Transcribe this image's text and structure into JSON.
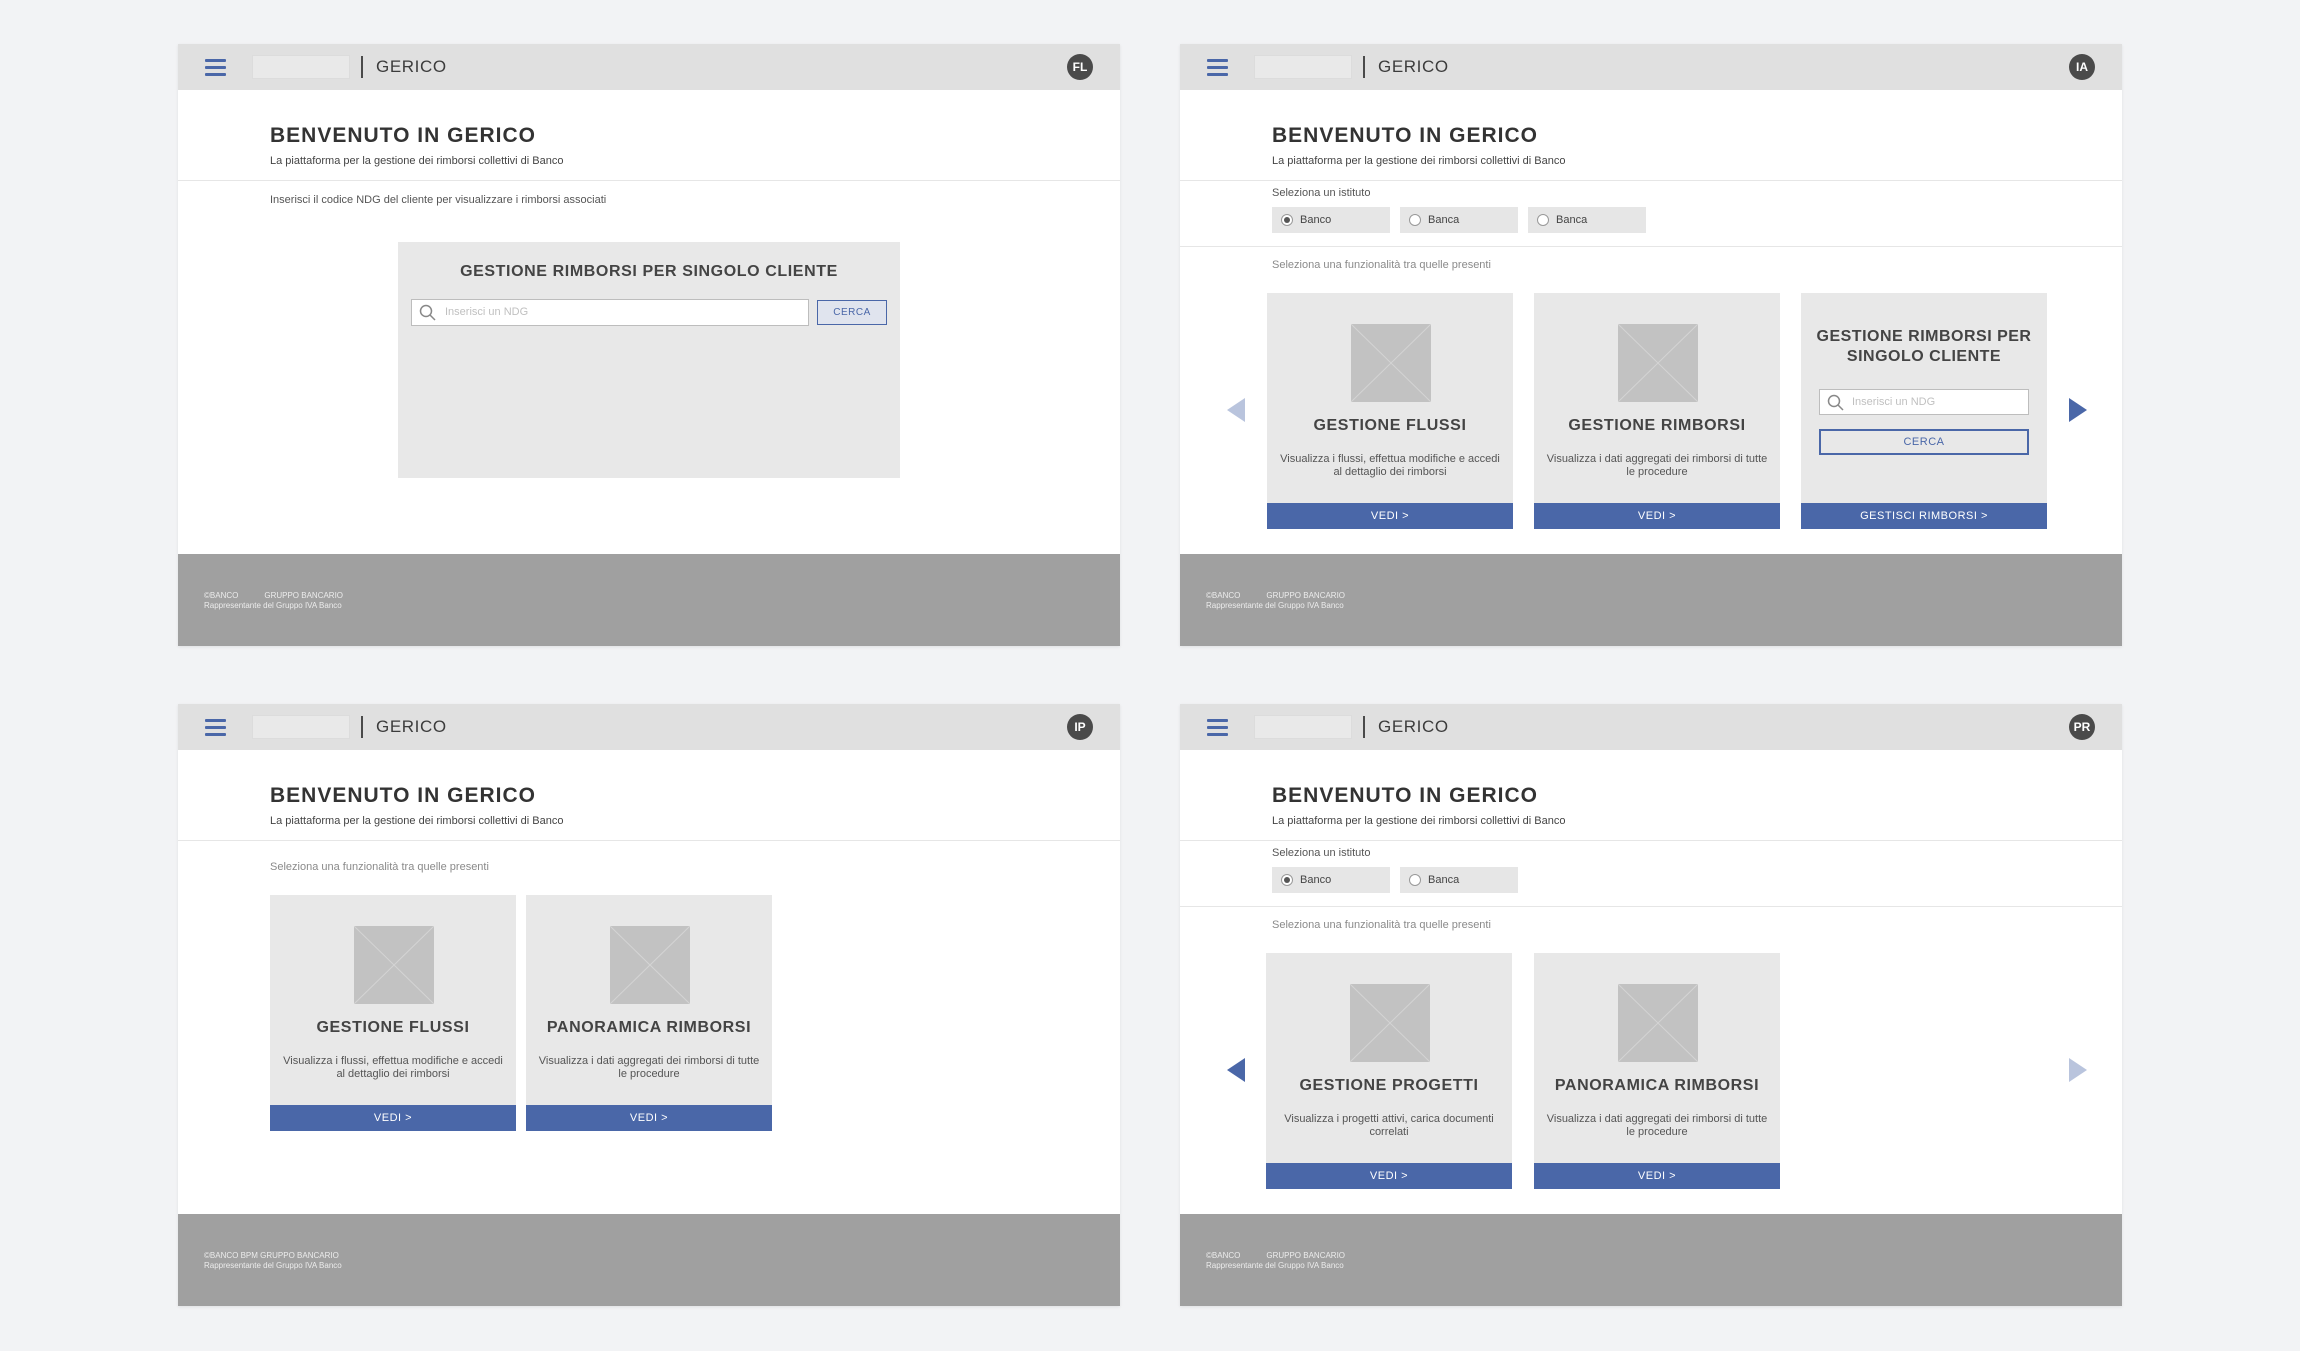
{
  "shared": {
    "app_name": "GERICO",
    "welcome_title": "BENVENUTO IN GERICO",
    "welcome_subtitle": "La piattaforma per la gestione dei rimborsi collettivi di Banco",
    "select_institute_label": "Seleziona un istituto",
    "select_function_hint": "Seleziona una funzionalità tra quelle presenti",
    "search_placeholder": "Inserisci un NDG",
    "cta_view": "VEDI >",
    "footer_copyright": "©BANCO",
    "footer_group": "GRUPPO BANCARIO",
    "footer_group_full": "©BANCO BPM GRUPPO BANCARIO",
    "footer_vat": "Rappresentante del Gruppo IVA Banco"
  },
  "screen1": {
    "avatar": "FL",
    "ndg_hint": "Inserisci il codice NDG del cliente per visualizzare i rimborsi associati",
    "panel_title": "GESTIONE RIMBORSI PER SINGOLO CLIENTE",
    "search_button": "CERCA"
  },
  "screen2": {
    "avatar": "IA",
    "institutes": [
      {
        "label": "Banco",
        "selected": true
      },
      {
        "label": "Banca",
        "selected": false
      },
      {
        "label": "Banca",
        "selected": false
      }
    ],
    "cards": [
      {
        "title": "GESTIONE FLUSSI",
        "desc": "Visualizza i flussi, effettua modifiche e accedi al dettaglio dei rimborsi",
        "cta": "VEDI >"
      },
      {
        "title": "GESTIONE RIMBORSI",
        "desc": "Visualizza i dati aggregati dei rimborsi di tutte le procedure",
        "cta": "VEDI >"
      },
      {
        "title": "GESTIONE RIMBORSI PER SINGOLO CLIENTE",
        "search_button": "CERCA",
        "cta": "GESTISCI RIMBORSI >"
      }
    ]
  },
  "screen3": {
    "avatar": "IP",
    "cards": [
      {
        "title": "GESTIONE FLUSSI",
        "desc": "Visualizza i flussi, effettua modifiche e accedi al dettaglio dei rimborsi",
        "cta": "VEDI >"
      },
      {
        "title": "PANORAMICA RIMBORSI",
        "desc": "Visualizza i dati aggregati dei rimborsi di tutte le procedure",
        "cta": "VEDI >"
      }
    ]
  },
  "screen4": {
    "avatar": "PR",
    "institutes": [
      {
        "label": "Banco",
        "selected": true
      },
      {
        "label": "Banca",
        "selected": false
      }
    ],
    "cards": [
      {
        "title": "GESTIONE PROGETTI",
        "desc": "Visualizza i progetti attivi, carica documenti correlati",
        "cta": "VEDI >"
      },
      {
        "title": "PANORAMICA RIMBORSI",
        "desc": "Visualizza i dati aggregati dei rimborsi di tutte le procedure",
        "cta": "VEDI >"
      }
    ]
  },
  "colors": {
    "accent": "#4a67a8",
    "arrow_disabled": "#b9c4dd",
    "card_bg": "#e8e8e8",
    "topbar_bg": "#e0e0e0",
    "footer_bg": "#a0a0a0",
    "avatar_bg": "#4a4a4a"
  }
}
